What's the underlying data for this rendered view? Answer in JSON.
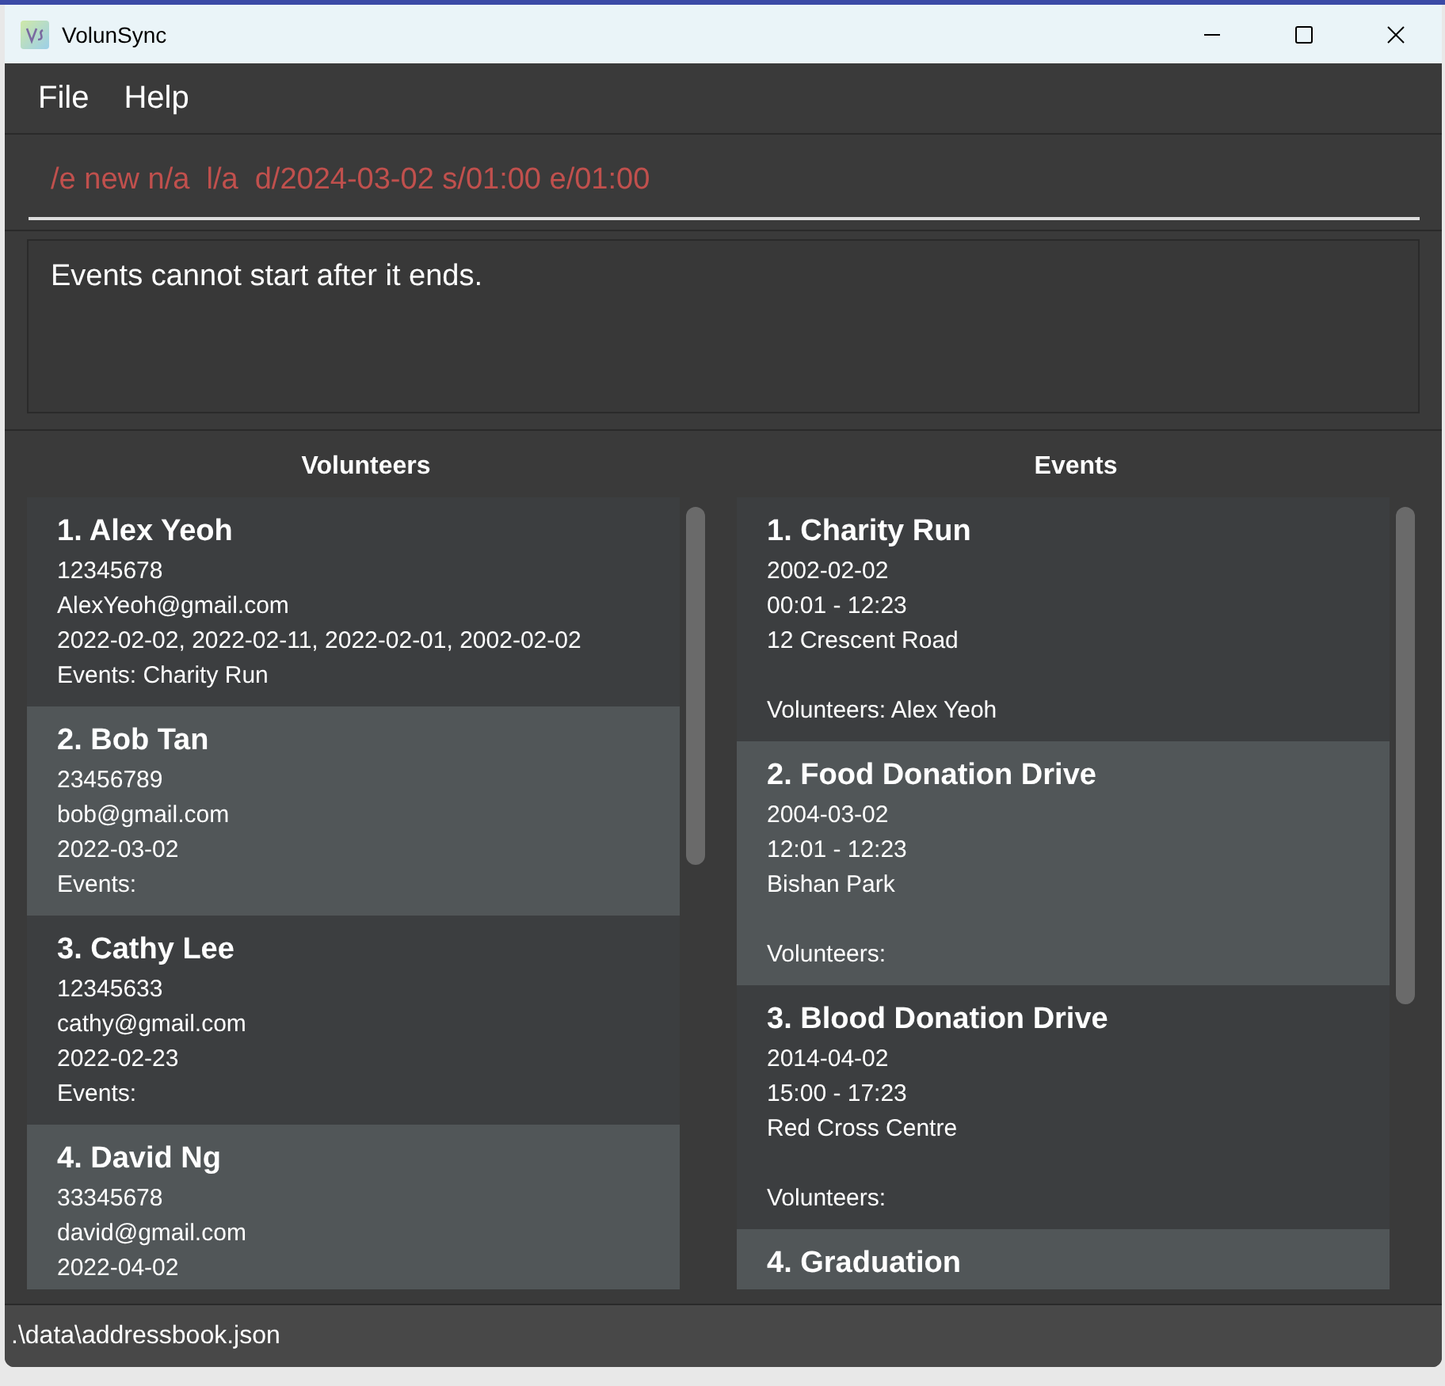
{
  "window": {
    "title": "VolunSync"
  },
  "menu": [
    "File",
    "Help"
  ],
  "command": {
    "value": "/e new n/a  l/a  d/2024-03-02 s/01:00 e/01:00",
    "error": true
  },
  "result": "Events cannot start after it ends.",
  "volunteers": {
    "title": "Volunteers",
    "items": [
      {
        "name": "1. Alex Yeoh",
        "phone": "12345678",
        "email": "AlexYeoh@gmail.com",
        "dates": "2022-02-02, 2022-02-11, 2022-02-01, 2002-02-02",
        "events": "Events: Charity Run"
      },
      {
        "name": "2. Bob Tan",
        "phone": "23456789",
        "email": "bob@gmail.com",
        "dates": "2022-03-02",
        "events": "Events:"
      },
      {
        "name": "3. Cathy Lee",
        "phone": "12345633",
        "email": "cathy@gmail.com",
        "dates": "2022-02-23",
        "events": "Events:"
      },
      {
        "name": "4. David Ng",
        "phone": "33345678",
        "email": "david@gmail.com",
        "dates": "2022-04-02"
      }
    ]
  },
  "events": {
    "title": "Events",
    "items": [
      {
        "name": "1. Charity Run",
        "date": "2002-02-02",
        "time": "00:01 - 12:23",
        "location": "12 Crescent Road",
        "volunteers": "Volunteers: Alex Yeoh"
      },
      {
        "name": "2. Food Donation Drive",
        "date": "2004-03-02",
        "time": "12:01 - 12:23",
        "location": "Bishan Park",
        "volunteers": "Volunteers:"
      },
      {
        "name": "3. Blood Donation Drive",
        "date": "2014-04-02",
        "time": "15:00 - 17:23",
        "location": "Red Cross Centre",
        "volunteers": "Volunteers:"
      },
      {
        "name": "4. Graduation"
      }
    ]
  },
  "status_bar": ".\\data\\addressbook.json"
}
